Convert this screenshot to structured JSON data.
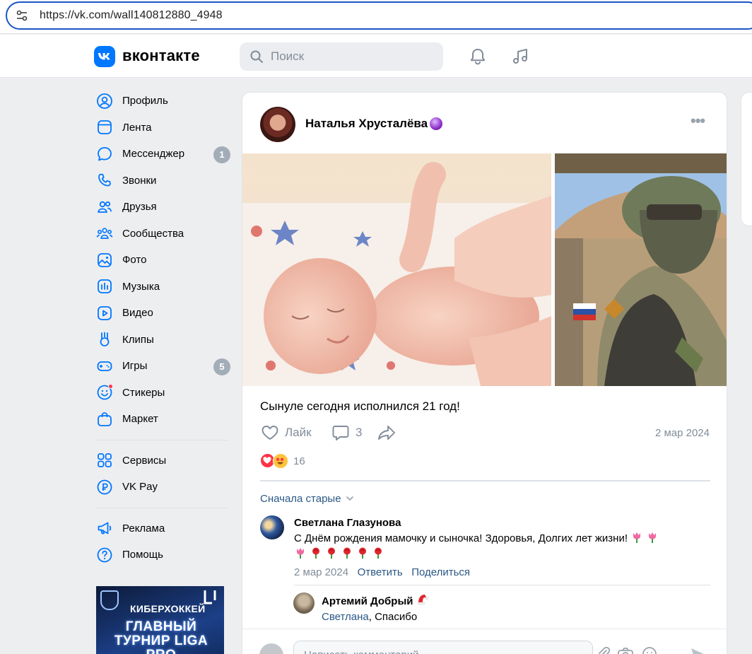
{
  "browser": {
    "url": "https://vk.com/wall140812880_4948"
  },
  "header": {
    "logo_text": "вконтакте",
    "search_placeholder": "Поиск"
  },
  "sidebar": {
    "items": [
      {
        "label": "Профиль",
        "icon": "profile-icon"
      },
      {
        "label": "Лента",
        "icon": "feed-icon"
      },
      {
        "label": "Мессенджер",
        "icon": "messenger-icon",
        "badge": "1"
      },
      {
        "label": "Звонки",
        "icon": "phone-icon"
      },
      {
        "label": "Друзья",
        "icon": "friends-icon"
      },
      {
        "label": "Сообщества",
        "icon": "communities-icon"
      },
      {
        "label": "Фото",
        "icon": "photo-icon"
      },
      {
        "label": "Музыка",
        "icon": "music-icon"
      },
      {
        "label": "Видео",
        "icon": "video-icon"
      },
      {
        "label": "Клипы",
        "icon": "clips-icon"
      },
      {
        "label": "Игры",
        "icon": "games-icon",
        "badge": "5"
      },
      {
        "label": "Стикеры",
        "icon": "stickers-icon"
      },
      {
        "label": "Маркет",
        "icon": "market-icon"
      }
    ],
    "secondary": [
      {
        "label": "Сервисы",
        "icon": "services-icon"
      },
      {
        "label": "VK Pay",
        "icon": "vkpay-icon"
      }
    ],
    "tertiary": [
      {
        "label": "Реклама",
        "icon": "ads-icon"
      },
      {
        "label": "Помощь",
        "icon": "help-icon"
      }
    ],
    "ad": {
      "line1": "КИБЕРХОККЕЙ",
      "line2": "ГЛАВНЫЙ ТУРНИР LIGA PRO"
    }
  },
  "post": {
    "author": "Наталья Хрусталёва",
    "text": "Сынуле сегодня исполнился 21 год!",
    "like_label": "Лайк",
    "comments_count": "3",
    "date": "2 мар 2024",
    "reactions_count": "16",
    "sort_label": "Сначала старые"
  },
  "comments": [
    {
      "author": "Светлана Глазунова",
      "text": "С Днём рождения мамочку и сыночка! Здоровья, Долгих лет жизни!",
      "date": "2 мар 2024",
      "reply_label": "Ответить",
      "share_label": "Поделиться"
    },
    {
      "author": "Артемий Добрый",
      "mention": "Светлана",
      "text": ", Спасибо"
    }
  ],
  "composer": {
    "placeholder": "Написать комментарий..."
  },
  "colors": {
    "accent": "#0077ff",
    "link": "#2a5885",
    "secondary_text": "#818c99",
    "badge": "#a3adb8",
    "background": "#edeef0"
  }
}
